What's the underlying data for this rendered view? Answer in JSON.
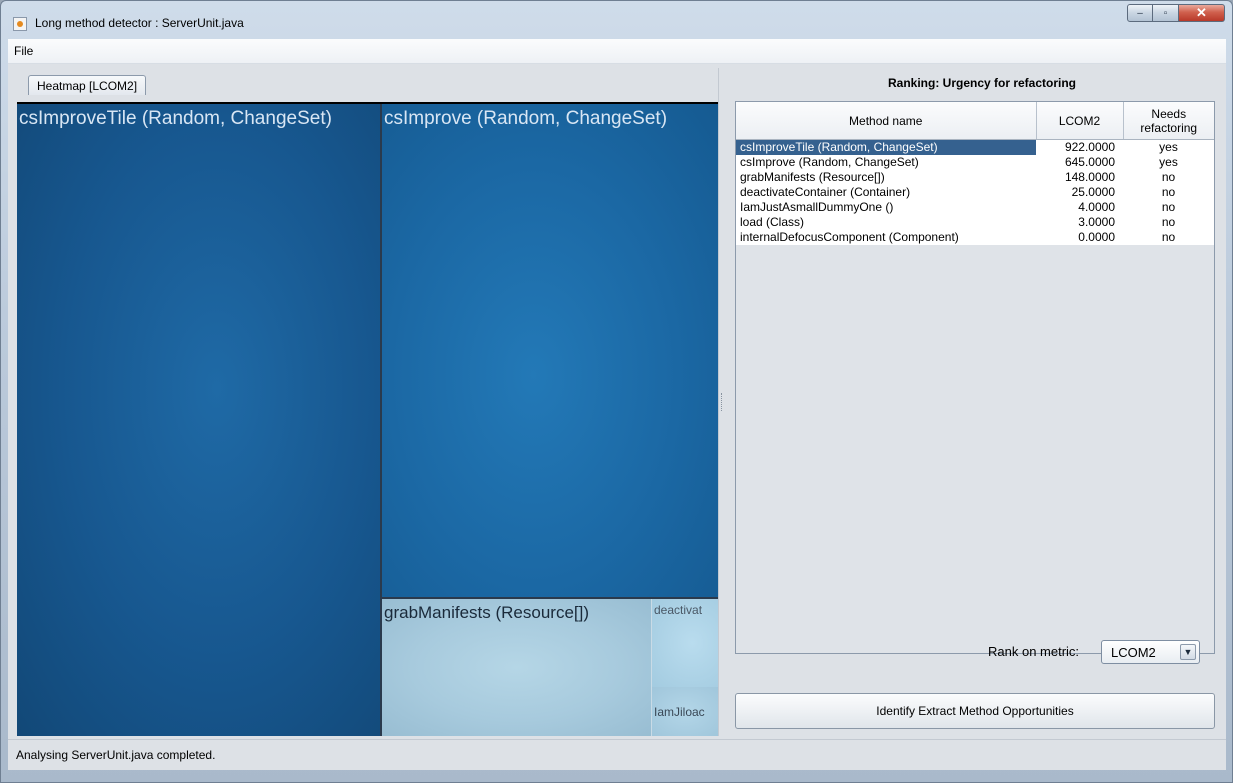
{
  "window": {
    "title": "Long method detector : ServerUnit.java",
    "controls": {
      "minimize": "–",
      "maximize": "▫",
      "close": "✕"
    }
  },
  "menu": {
    "file": "File"
  },
  "heatmap": {
    "tab_label": "Heatmap [LCOM2]",
    "cells": [
      {
        "label": "csImproveTile (Random, ChangeSet)",
        "metric": 922
      },
      {
        "label": "csImprove (Random, ChangeSet)",
        "metric": 645
      },
      {
        "label": "grabManifests (Resource[])",
        "metric": 148
      },
      {
        "label": "deactivat",
        "metric": 25
      },
      {
        "label": "IamJiloac",
        "metric": 4
      }
    ]
  },
  "ranking": {
    "title": "Ranking: Urgency for refactoring",
    "headers": {
      "method": "Method name",
      "metric": "LCOM2",
      "needs_line1": "Needs",
      "needs_line2": "refactoring"
    },
    "rows": [
      {
        "method": "csImproveTile (Random, ChangeSet)",
        "value": "922.0000",
        "needs": "yes",
        "selected": true
      },
      {
        "method": "csImprove (Random, ChangeSet)",
        "value": "645.0000",
        "needs": "yes",
        "selected": false
      },
      {
        "method": "grabManifests (Resource[])",
        "value": "148.0000",
        "needs": "no",
        "selected": false
      },
      {
        "method": "deactivateContainer (Container)",
        "value": "25.0000",
        "needs": "no",
        "selected": false
      },
      {
        "method": "IamJustAsmallDummyOne ()",
        "value": "4.0000",
        "needs": "no",
        "selected": false
      },
      {
        "method": "load (Class)",
        "value": "3.0000",
        "needs": "no",
        "selected": false
      },
      {
        "method": "internalDefocusComponent (Component)",
        "value": "0.0000",
        "needs": "no",
        "selected": false
      }
    ],
    "metric_label": "Rank on metric:",
    "metric_value": "LCOM2",
    "action_button": "Identify Extract Method Opportunities"
  },
  "status": {
    "text": "Analysing ServerUnit.java completed."
  }
}
